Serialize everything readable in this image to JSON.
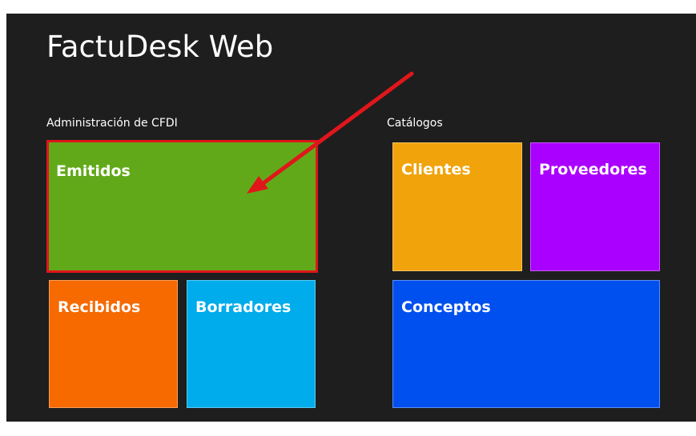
{
  "app": {
    "title": "FactuDesk Web"
  },
  "sections": {
    "cfdi": {
      "label": "Administración de CFDI",
      "tiles": {
        "emitidos": {
          "label": "Emitidos",
          "color": "#62a919"
        },
        "recibidos": {
          "label": "Recibidos",
          "color": "#f66a00"
        },
        "borradores": {
          "label": "Borradores",
          "color": "#00aceb"
        }
      }
    },
    "catalogos": {
      "label": "Catálogos",
      "tiles": {
        "clientes": {
          "label": "Clientes",
          "color": "#f0a30a"
        },
        "proveedores": {
          "label": "Proveedores",
          "color": "#aa00ff"
        },
        "conceptos": {
          "label": "Conceptos",
          "color": "#0050ef"
        }
      }
    }
  },
  "annotation": {
    "arrow_color": "#e0161b",
    "highlight_color": "#e0161b"
  }
}
